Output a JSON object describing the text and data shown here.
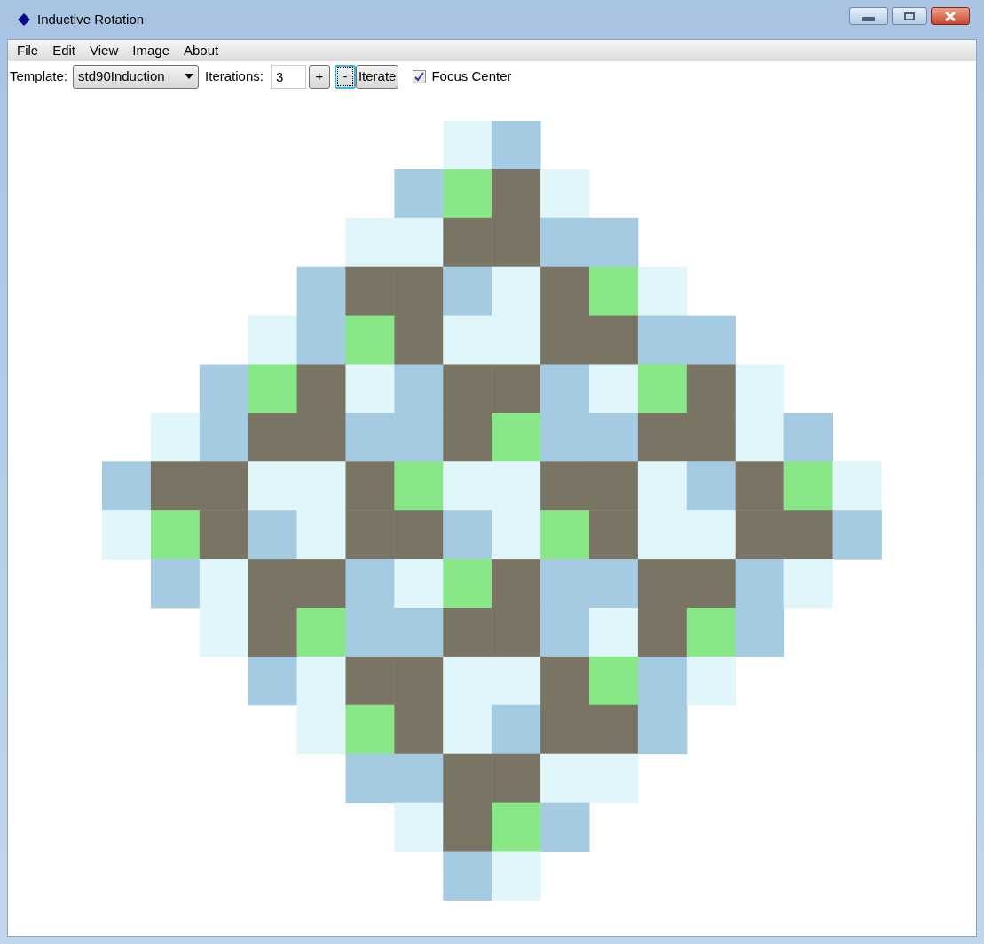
{
  "window": {
    "title": "Inductive Rotation"
  },
  "menu": [
    "File",
    "Edit",
    "View",
    "Image",
    "About"
  ],
  "toolbar": {
    "template_label": "Template:",
    "template_value": "std90Induction",
    "iterations_label": "Iterations:",
    "iterations_value": "3",
    "buttons": [
      {
        "label": "+",
        "focused": false
      },
      {
        "label": "-",
        "focused": true
      },
      {
        "label": "Iterate",
        "focused": false
      }
    ],
    "focus_center": {
      "label": "Focus Center",
      "checked": true
    }
  }
}
